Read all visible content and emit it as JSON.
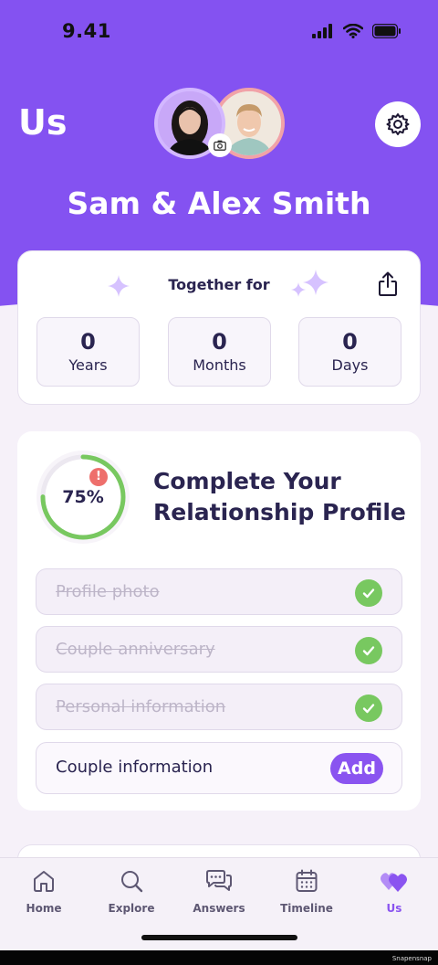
{
  "status_bar": {
    "time": "9.41"
  },
  "header": {
    "title": "Us",
    "couple_name": "Sam & Alex Smith"
  },
  "together": {
    "label": "Together for",
    "stats": [
      {
        "value": "0",
        "label": "Years"
      },
      {
        "value": "0",
        "label": "Months"
      },
      {
        "value": "0",
        "label": "Days"
      }
    ]
  },
  "profile": {
    "percent": "75%",
    "progress": 0.75,
    "alert": "!",
    "title": "Complete Your Relationship Profile",
    "tasks": [
      {
        "label": "Profile photo",
        "done": true
      },
      {
        "label": "Couple anniversary",
        "done": true
      },
      {
        "label": "Personal information",
        "done": true
      },
      {
        "label": "Couple information",
        "done": false,
        "action": "Add"
      }
    ]
  },
  "tabs": [
    {
      "label": "Home",
      "icon": "home-icon"
    },
    {
      "label": "Explore",
      "icon": "search-icon"
    },
    {
      "label": "Answers",
      "icon": "chat-bubbles-icon"
    },
    {
      "label": "Timeline",
      "icon": "calendar-icon"
    },
    {
      "label": "Us",
      "icon": "hearts-icon",
      "active": true
    }
  ],
  "watermark": "Snapensnap",
  "colors": {
    "brand": "#8452f1",
    "accent": "#8a54f0",
    "success": "#78c860",
    "alert": "#ee6f6c",
    "text": "#2a2450"
  }
}
